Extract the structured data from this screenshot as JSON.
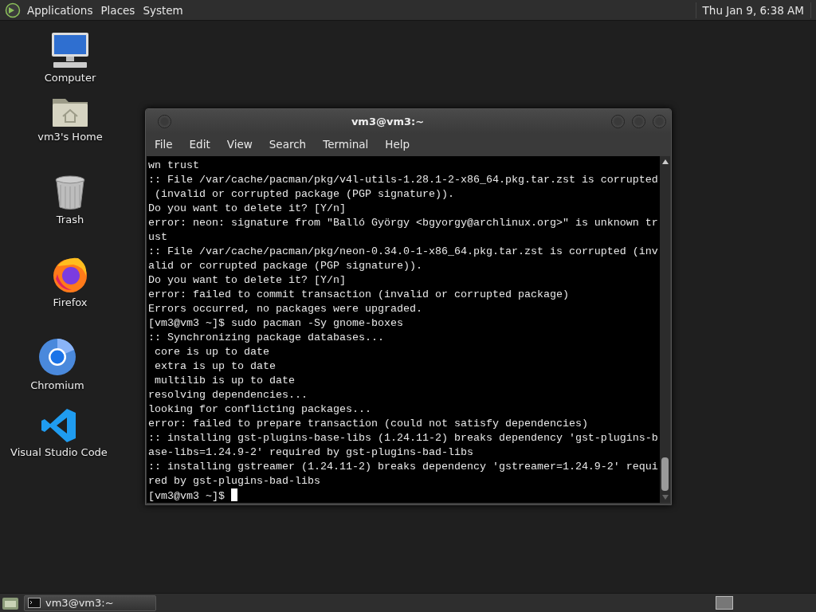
{
  "top_panel": {
    "menus": [
      "Applications",
      "Places",
      "System"
    ],
    "clock": "Thu Jan 9, 6:38 AM"
  },
  "desktop_icons": [
    {
      "kind": "computer",
      "label": "Computer"
    },
    {
      "kind": "home",
      "label": "vm3's Home"
    },
    {
      "kind": "trash",
      "label": "Trash"
    },
    {
      "kind": "firefox",
      "label": "Firefox"
    },
    {
      "kind": "chromium",
      "label": "Chromium"
    },
    {
      "kind": "vscode",
      "label": "Visual Studio Code"
    }
  ],
  "terminal_window": {
    "title": "vm3@vm3:~",
    "menu": [
      "File",
      "Edit",
      "View",
      "Search",
      "Terminal",
      "Help"
    ],
    "lines": [
      "wn trust",
      ":: File /var/cache/pacman/pkg/v4l-utils-1.28.1-2-x86_64.pkg.tar.zst is corrupted",
      " (invalid or corrupted package (PGP signature)).",
      "Do you want to delete it? [Y/n]",
      "error: neon: signature from \"Balló György <bgyorgy@archlinux.org>\" is unknown tr",
      "ust",
      ":: File /var/cache/pacman/pkg/neon-0.34.0-1-x86_64.pkg.tar.zst is corrupted (inv",
      "alid or corrupted package (PGP signature)).",
      "Do you want to delete it? [Y/n]",
      "error: failed to commit transaction (invalid or corrupted package)",
      "Errors occurred, no packages were upgraded.",
      "[vm3@vm3 ~]$ sudo pacman -Sy gnome-boxes",
      ":: Synchronizing package databases...",
      " core is up to date",
      " extra is up to date",
      " multilib is up to date",
      "resolving dependencies...",
      "looking for conflicting packages...",
      "error: failed to prepare transaction (could not satisfy dependencies)",
      ":: installing gst-plugins-base-libs (1.24.11-2) breaks dependency 'gst-plugins-b",
      "ase-libs=1.24.9-2' required by gst-plugins-bad-libs",
      ":: installing gstreamer (1.24.11-2) breaks dependency 'gstreamer=1.24.9-2' requi",
      "red by gst-plugins-bad-libs",
      "[vm3@vm3 ~]$ "
    ],
    "cursor": true
  },
  "taskbar": {
    "tasks": [
      {
        "label": "vm3@vm3:~",
        "selected": false
      }
    ]
  }
}
